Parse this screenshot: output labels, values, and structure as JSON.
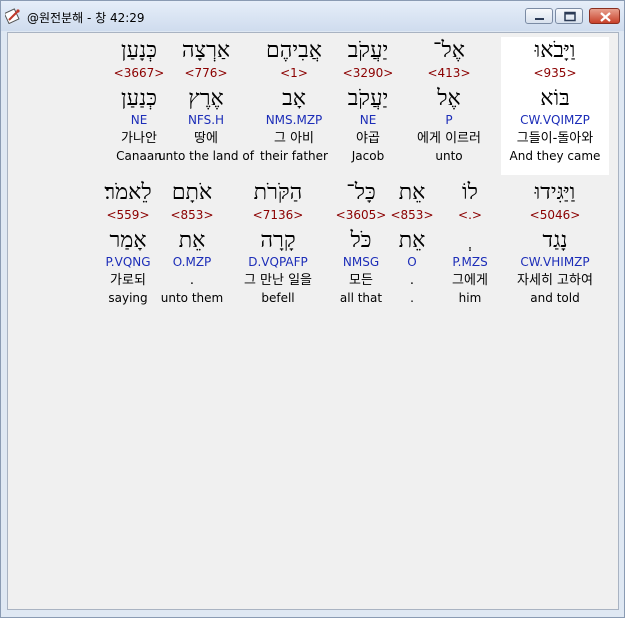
{
  "window": {
    "title": "@원전분해 - 창 42:29"
  },
  "rows": [
    {
      "words": [
        {
          "heb": "וַיָּבֹאוּ",
          "strong": "<935>",
          "lemma": "בּוֹא",
          "morph": "CW.VQIMZP",
          "kor": "그들이-돌아와",
          "eng": "And they came",
          "selected": true
        },
        {
          "heb": "אֶל־",
          "strong": "<413>",
          "lemma": "אֶל",
          "morph": "P",
          "kor": "에게 이르러",
          "eng": "unto",
          "selected": false
        },
        {
          "heb": "יַעֲקֹב",
          "strong": "<3290>",
          "lemma": "יַעֲקֹב",
          "morph": "NE",
          "kor": "야곱",
          "eng": "Jacob",
          "selected": false
        },
        {
          "heb": "אֲבִיהֶם",
          "strong": "<1>",
          "lemma": "אָב",
          "morph": "NMS.MZP",
          "kor": "그 아비",
          "eng": "their father",
          "selected": false
        },
        {
          "heb": "אַרְצָה",
          "strong": "<776>",
          "lemma": "אֶרֶץ",
          "morph": "NFS.H",
          "kor": "땅에",
          "eng": "unto the land of",
          "selected": false
        },
        {
          "heb": "כְּנָעַן",
          "strong": "<3667>",
          "lemma": "כְּנַעַן",
          "morph": "NE",
          "kor": "가나안",
          "eng": "Canaan",
          "selected": false
        }
      ]
    },
    {
      "words": [
        {
          "heb": "וַיַּגִּידוּ",
          "strong": "<5046>",
          "lemma": "נָגַד",
          "morph": "CW.VHIMZP",
          "kor": "자세히 고하여",
          "eng": "and told",
          "selected": false
        },
        {
          "heb": "לוֹ",
          "strong": "<.>",
          "lemma": "ְ",
          "morph": "P.MZS",
          "kor": "그에게",
          "eng": "him",
          "selected": false
        },
        {
          "heb": "אֵת",
          "strong": "<853>",
          "lemma": "אֵת",
          "morph": "O",
          "kor": ".",
          "eng": ".",
          "selected": false
        },
        {
          "heb": "כָּל־",
          "strong": "<3605>",
          "lemma": "כֹּל",
          "morph": "NMSG",
          "kor": "모든",
          "eng": "all that",
          "selected": false
        },
        {
          "heb": "הַקֹּרֹת",
          "strong": "<7136>",
          "lemma": "קָרָה",
          "morph": "D.VQPAFP",
          "kor": "그 만난 일을",
          "eng": "befell",
          "selected": false
        },
        {
          "heb": "אֹתָם",
          "strong": "<853>",
          "lemma": "אֵת",
          "morph": "O.MZP",
          "kor": ".",
          "eng": "unto them",
          "selected": false
        },
        {
          "heb": "לֵאמֹר׃",
          "strong": "<559>",
          "lemma": "אָמַר",
          "morph": "P.VQNG",
          "kor": "가로되",
          "eng": "saying",
          "selected": false
        }
      ]
    }
  ]
}
